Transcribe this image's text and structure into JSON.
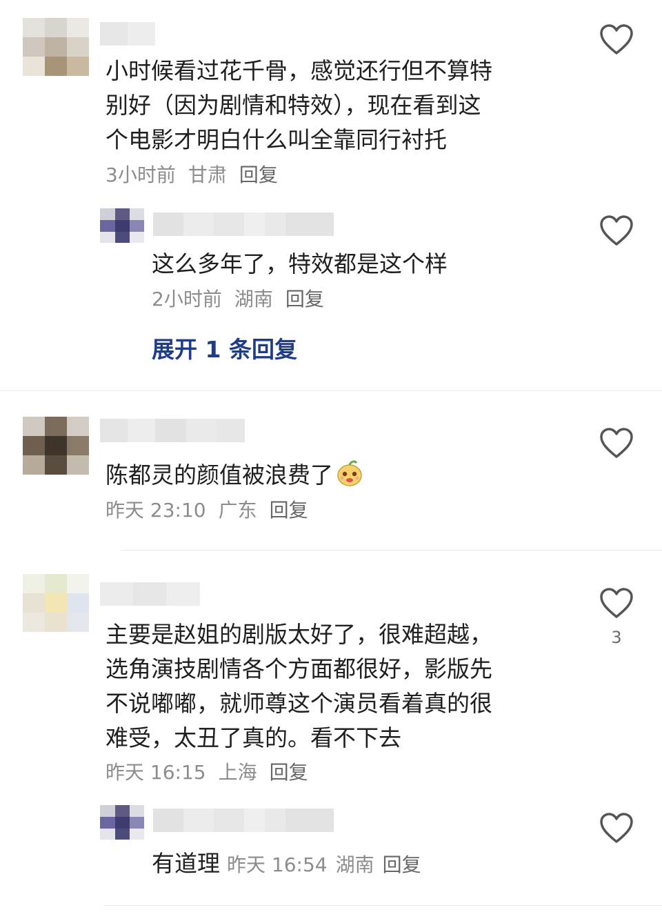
{
  "comments": [
    {
      "text_lines": [
        "小时候看过花千骨，感觉还行但不算特",
        "别好（因为剧情和特效），现在看到这",
        "个电影才明白什么叫全靠同行衬托"
      ],
      "time": "3小时前",
      "location": "甘肃",
      "reply_label": "回复",
      "reply": {
        "text": "这么多年了，特效都是这个样",
        "time": "2小时前",
        "location": "湖南",
        "reply_label": "回复"
      },
      "expand_label": "展开 1 条回复"
    },
    {
      "text": "陈都灵的颜值被浪费了",
      "emoji": "smiling-mascot-emoji",
      "time": "昨天 23:10",
      "location": "广东",
      "reply_label": "回复"
    },
    {
      "text_lines": [
        "主要是赵姐的剧版太好了，很难超越，",
        "选角演技剧情各个方面都很好，影版先",
        "不说嘟嘟，就师尊这个演员看着真的很",
        "难受，太丑了真的。看不下去"
      ],
      "time": "昨天 16:15",
      "location": "上海",
      "reply_label": "回复",
      "like_count": "3",
      "reply": {
        "text": "有道理",
        "time": "昨天 16:54",
        "location": "湖南",
        "reply_label": "回复"
      }
    }
  ],
  "icons": {
    "like": "heart-outline-icon"
  },
  "colors": {
    "expand_link": "#1f3c88",
    "meta": "#8c8c8c",
    "heart_stroke": "#555555"
  }
}
